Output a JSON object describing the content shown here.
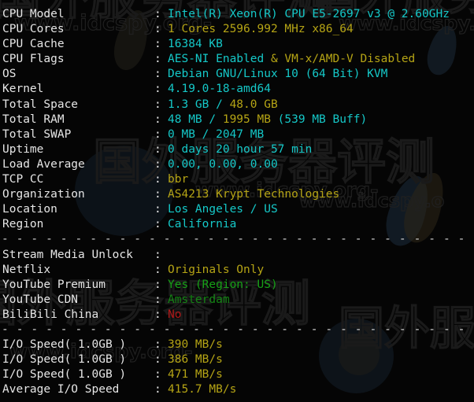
{
  "terminal": {
    "separator": "- - - - - - - - - - - - - - - - - - - - - - - - - - - - - - - - - - - - - - - - - - - - - - - - - - - - -",
    "colon": ":",
    "colors": {
      "background": "#050505",
      "label": "#e6e6e6",
      "cyan": "#15c8c8",
      "yellow": "#b5a415",
      "green": "#16a016",
      "red": "#b01818"
    }
  },
  "watermark": {
    "text_cjk_1": "国外服务器评测",
    "text_cjk_2": "国外服务器评测",
    "url_1": "www.idcspy.org-",
    "url_2": "www.idcspy.o",
    "url_3": "www.idcspy.org-"
  },
  "system_info": [
    {
      "label": "CPU Model",
      "parts": [
        {
          "text": "Intel(R) Xeon(R) CPU E5-2697 v3 @ 2.60GHz",
          "color": "cyan"
        }
      ]
    },
    {
      "label": "CPU Cores",
      "parts": [
        {
          "text": "1 Cores 2596.992 MHz x86_64",
          "color": "yellow"
        }
      ]
    },
    {
      "label": "CPU Cache",
      "parts": [
        {
          "text": "16384 KB",
          "color": "cyan"
        }
      ]
    },
    {
      "label": "CPU Flags",
      "parts": [
        {
          "text": "AES-NI Enabled ",
          "color": "cyan"
        },
        {
          "text": "& VM-x/AMD-V Disabled",
          "color": "yellow"
        }
      ]
    },
    {
      "label": "OS",
      "parts": [
        {
          "text": "Debian GNU/Linux 10 (64 Bit) KVM",
          "color": "cyan"
        }
      ]
    },
    {
      "label": "Kernel",
      "parts": [
        {
          "text": "4.19.0-18-amd64",
          "color": "cyan"
        }
      ]
    },
    {
      "label": "Total Space",
      "parts": [
        {
          "text": "1.3 GB / ",
          "color": "cyan"
        },
        {
          "text": "48.0 GB",
          "color": "yellow"
        }
      ]
    },
    {
      "label": "Total RAM",
      "parts": [
        {
          "text": "48 MB / ",
          "color": "cyan"
        },
        {
          "text": "1995 MB",
          "color": "yellow"
        },
        {
          "text": " (539 MB Buff)",
          "color": "cyan"
        }
      ]
    },
    {
      "label": "Total SWAP",
      "parts": [
        {
          "text": "0 MB / 2047 MB",
          "color": "cyan"
        }
      ]
    },
    {
      "label": "Uptime",
      "parts": [
        {
          "text": "0 days 20 hour 57 min",
          "color": "cyan"
        }
      ]
    },
    {
      "label": "Load Average",
      "parts": [
        {
          "text": "0.00, 0.00, 0.00",
          "color": "cyan"
        }
      ]
    },
    {
      "label": "TCP CC",
      "parts": [
        {
          "text": "bbr",
          "color": "yellow"
        }
      ]
    },
    {
      "label": "Organization",
      "parts": [
        {
          "text": "AS4213 Krypt Technologies",
          "color": "yellow"
        }
      ]
    },
    {
      "label": "Location",
      "parts": [
        {
          "text": "Los Angeles / US",
          "color": "cyan"
        }
      ]
    },
    {
      "label": "Region",
      "parts": [
        {
          "text": "California",
          "color": "cyan"
        }
      ]
    }
  ],
  "stream_media": [
    {
      "label": "Stream Media Unlock",
      "parts": []
    },
    {
      "label": "Netflix",
      "parts": [
        {
          "text": "Originals Only",
          "color": "yellow"
        }
      ]
    },
    {
      "label": "YouTube Premium",
      "parts": [
        {
          "text": "Yes (Region: US)",
          "color": "green"
        }
      ]
    },
    {
      "label": "YouTube CDN",
      "parts": [
        {
          "text": "Amsterdam",
          "color": "green"
        }
      ]
    },
    {
      "label": "BiliBili China",
      "parts": [
        {
          "text": "No",
          "color": "red"
        }
      ]
    }
  ],
  "io_speed": [
    {
      "label": "I/O Speed( 1.0GB )",
      "parts": [
        {
          "text": "390 MB/s",
          "color": "yellow"
        }
      ]
    },
    {
      "label": "I/O Speed( 1.0GB )",
      "parts": [
        {
          "text": "386 MB/s",
          "color": "yellow"
        }
      ]
    },
    {
      "label": "I/O Speed( 1.0GB )",
      "parts": [
        {
          "text": "471 MB/s",
          "color": "yellow"
        }
      ]
    },
    {
      "label": "Average I/O Speed",
      "parts": [
        {
          "text": "415.7 MB/s",
          "color": "yellow"
        }
      ]
    }
  ]
}
